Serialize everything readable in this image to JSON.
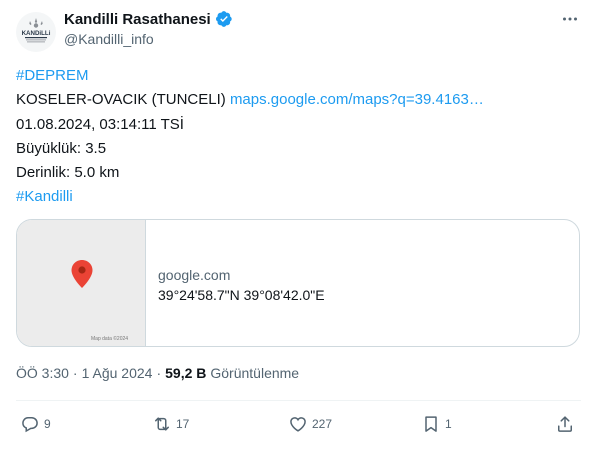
{
  "account": {
    "display_name": "Kandilli Rasathanesi",
    "handle": "@Kandilli_info",
    "avatar_text": "KANDiLLi"
  },
  "tweet": {
    "lines": {
      "hashtag1": "#DEPREM",
      "location": "KOSELER-OVACIK (TUNCELI)",
      "maps_link": "maps.google.com/maps?q=39.4163…",
      "datetime": "01.08.2024, 03:14:11 TSİ",
      "magnitude": "Büyüklük: 3.5",
      "depth": "Derinlik: 5.0 km",
      "hashtag2": "#Kandilli"
    }
  },
  "card": {
    "domain": "google.com",
    "title": "39°24'58.7\"N 39°08'42.0\"E",
    "map_credit": "Map data ©2024"
  },
  "meta": {
    "time": "ÖÖ 3:30",
    "separator": "·",
    "date": "1 Ağu 2024",
    "views_count": "59,2 B",
    "views_label": "Görüntülenme"
  },
  "actions": {
    "replies": "9",
    "reposts": "17",
    "likes": "227",
    "bookmarks": "1"
  },
  "colors": {
    "accent": "#1d9bf0",
    "text": "#0f1419",
    "secondary": "#536471",
    "pin": "#ea4335"
  },
  "icons": {
    "more": "more-dots-icon",
    "verified": "verified-badge-icon",
    "reply": "reply-icon",
    "repost": "repost-icon",
    "like": "heart-icon",
    "bookmark": "bookmark-icon",
    "share": "share-icon",
    "pin": "map-pin-icon"
  }
}
